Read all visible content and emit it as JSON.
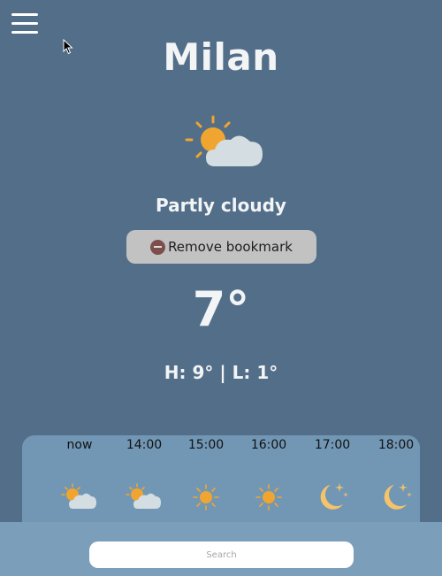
{
  "city": "Milan",
  "condition": "Partly cloudy",
  "bookmark_button": "Remove bookmark",
  "temperature": "7°",
  "high_low": "H: 9° | L: 1°",
  "hourly": [
    {
      "time": "now",
      "icon": "partly-cloudy-icon"
    },
    {
      "time": "14:00",
      "icon": "partly-cloudy-icon"
    },
    {
      "time": "15:00",
      "icon": "sun-icon"
    },
    {
      "time": "16:00",
      "icon": "sun-icon"
    },
    {
      "time": "17:00",
      "icon": "moon-stars-icon"
    },
    {
      "time": "18:00",
      "icon": "moon-stars-icon"
    }
  ],
  "search": {
    "placeholder": "Search",
    "value": ""
  },
  "colors": {
    "background": "#526e88",
    "hourly_panel": "#7297b5",
    "sun": "#f0a530",
    "cloud": "#d4dde2",
    "moon": "#f4c36a"
  }
}
